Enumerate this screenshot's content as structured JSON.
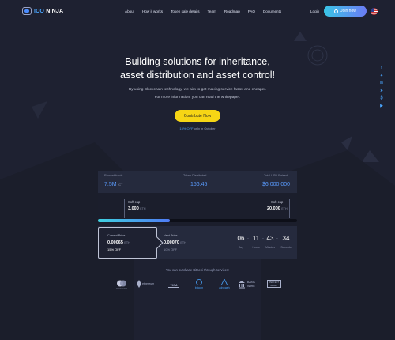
{
  "header": {
    "logo_prefix": "ICO",
    "logo_suffix": "NINJA",
    "nav": [
      "About",
      "How it works",
      "Token sale details",
      "Team",
      "Roadmap",
      "FAQ",
      "Documents"
    ],
    "login": "Login",
    "join": "Join now"
  },
  "hero": {
    "title_line1": "Building solutions for inheritance,",
    "title_line2": "asset distribution and asset control!",
    "sub_line1": "By using Blockchain technology, we aim to get making service faster and cheaper.",
    "sub_line2": "For more information, you can read the whitepaper.",
    "cta": "Contribute Now",
    "offer_pct": "15% OFF",
    "offer_rest": " only in October"
  },
  "social_icons": [
    "facebook-icon",
    "twitter-icon",
    "linkedin-icon",
    "telegram-icon",
    "bitcoin-icon",
    "youtube-icon"
  ],
  "stats": {
    "reward_label": "Reward funds",
    "reward_value": "7.5M",
    "reward_unit": "ICT",
    "distributed_label": "Token Distributed",
    "distributed_value": "156.45",
    "raised_label": "Total USD Raised",
    "raised_value": "$6.000.000"
  },
  "caps": {
    "soft_label": "Soft cap",
    "soft_value": "3,000",
    "soft_unit": "ETH",
    "hard_label": "Soft cap",
    "hard_value": "20,000",
    "hard_unit": "ETH",
    "progress": 0.36
  },
  "prices": {
    "current_label": "Current Price",
    "current_value": "0.00065",
    "current_unit": "ETH",
    "current_off": "15% OFF",
    "next_label": "Next Price",
    "next_value": "0.00070",
    "next_unit": "ETH",
    "next_off": "10% OFF"
  },
  "countdown": {
    "days": "06",
    "days_label": "Day",
    "hours": "11",
    "hours_label": "Hours",
    "minutes": "43",
    "minutes_label": "Minutes",
    "seconds": "34",
    "seconds_label": "Seconds"
  },
  "payments": {
    "heading": "You can purchase Bitbeni through services:",
    "items": [
      "Mastercard",
      "ethereum",
      "VISA",
      "bitcoin",
      "advcash",
      "BANK WIRE",
      "PERFECT MONEY"
    ]
  }
}
